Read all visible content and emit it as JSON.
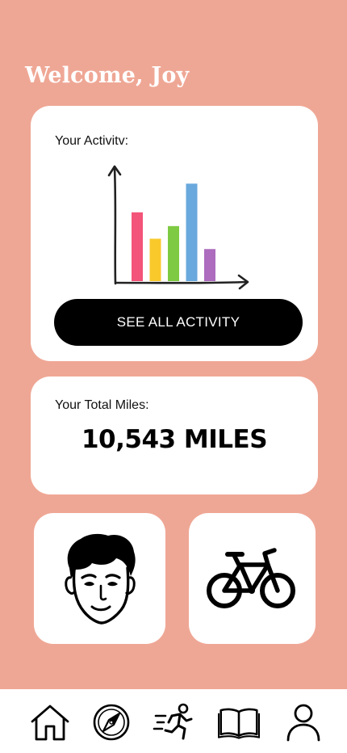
{
  "header": {
    "welcome": "Welcome, Joy"
  },
  "activity": {
    "label": "Your Activitv:",
    "button_label": "SEE ALL ACTIVITY",
    "bar_colors": [
      "#F2456E",
      "#F8C41A",
      "#73C532",
      "#5CA2DA",
      "#A660B8"
    ],
    "bar_levels": [
      0.6,
      0.37,
      0.48,
      0.85,
      0.28
    ]
  },
  "miles": {
    "label": "Your Total Miles:",
    "value": "10,543 MILES"
  },
  "tiles": [
    {
      "icon": "face-icon"
    },
    {
      "icon": "bicycle-icon"
    }
  ],
  "nav": {
    "items": [
      "home-icon",
      "compass-icon",
      "running-icon",
      "book-icon",
      "profile-icon"
    ]
  },
  "colors": {
    "background": "#EFA795",
    "card": "#FFFFFF",
    "button": "#000000"
  }
}
